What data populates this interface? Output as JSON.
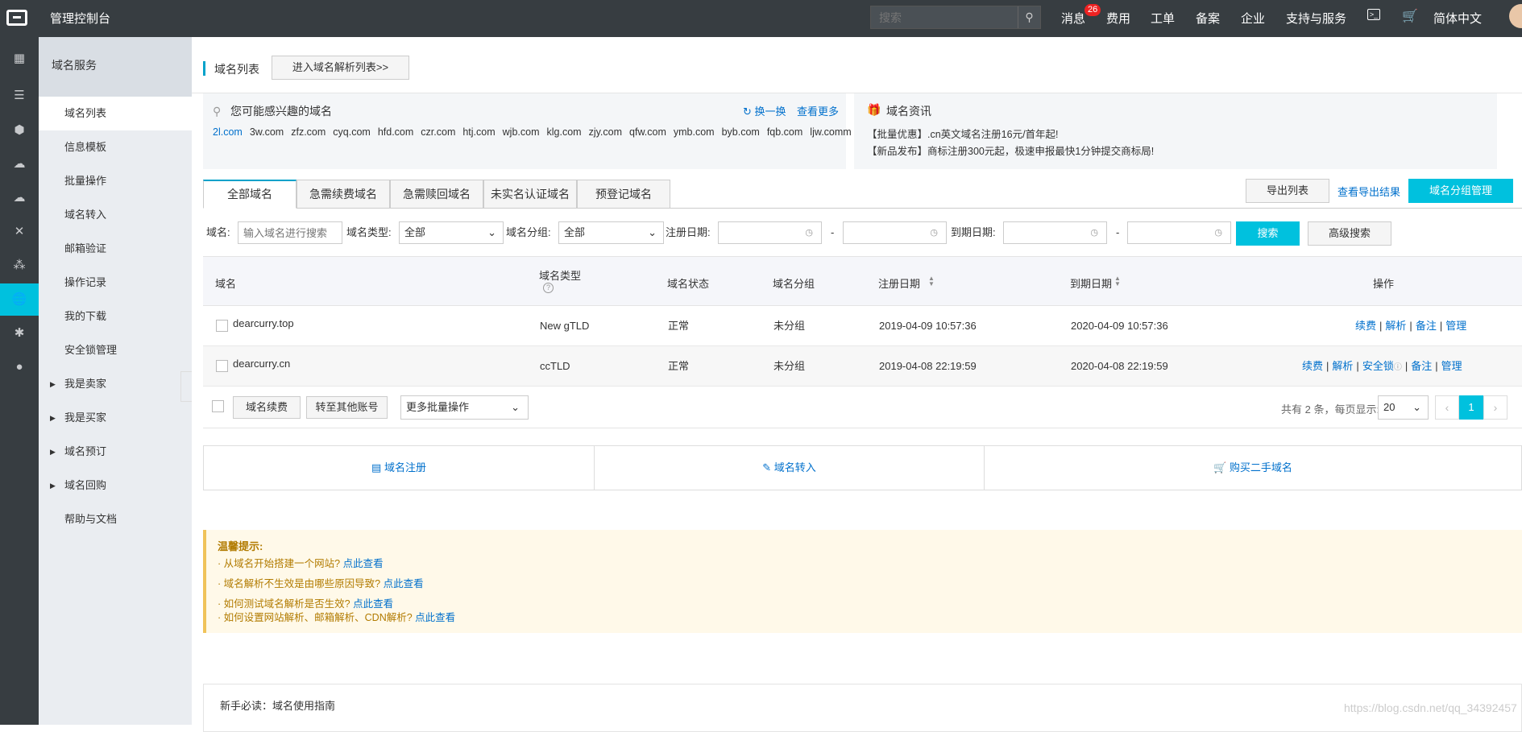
{
  "topbar": {
    "title": "管理控制台",
    "search_placeholder": "搜索",
    "nav": [
      "消息",
      "费用",
      "工单",
      "备案",
      "企业",
      "支持与服务",
      "简体中文"
    ],
    "messages_badge": "26"
  },
  "sidebar": {
    "header": "域名服务",
    "items": [
      {
        "label": "域名列表",
        "active": true,
        "expandable": false
      },
      {
        "label": "信息模板",
        "expandable": false
      },
      {
        "label": "批量操作",
        "expandable": false
      },
      {
        "label": "域名转入",
        "expandable": false
      },
      {
        "label": "邮箱验证",
        "expandable": false
      },
      {
        "label": "操作记录",
        "expandable": false
      },
      {
        "label": "我的下载",
        "expandable": false
      },
      {
        "label": "安全锁管理",
        "expandable": false
      },
      {
        "label": "我是卖家",
        "expandable": true
      },
      {
        "label": "我是买家",
        "expandable": true
      },
      {
        "label": "域名预订",
        "expandable": true
      },
      {
        "label": "域名回购",
        "expandable": true
      },
      {
        "label": "帮助与文档",
        "expandable": false
      }
    ]
  },
  "page": {
    "title": "域名列表",
    "goto_dns_button": "进入域名解析列表>>"
  },
  "suggest": {
    "title": "您可能感兴趣的域名",
    "refresh": "换一换",
    "more": "查看更多",
    "domains": [
      "2l.com",
      "3w.com",
      "zfz.com",
      "cyq.com",
      "hfd.com",
      "czr.com",
      "htj.com",
      "wjb.com",
      "klg.com",
      "zjy.com",
      "qfw.com",
      "ymb.com",
      "byb.com",
      "fqb.com",
      "ljw.comm"
    ]
  },
  "news": {
    "title": "域名资讯",
    "items": [
      "【批量优惠】.cn英文域名注册16元/首年起!",
      "【新品发布】商标注册300元起，极速申报最快1分钟提交商标局!"
    ]
  },
  "tabs": [
    "全部域名",
    "急需续费域名",
    "急需赎回域名",
    "未实名认证域名",
    "预登记域名"
  ],
  "toolbar": {
    "export": "导出列表",
    "view_export": "查看导出结果",
    "group_manage": "域名分组管理"
  },
  "filters": {
    "domain_label": "域名:",
    "domain_placeholder": "输入域名进行搜索",
    "type_label": "域名类型:",
    "type_value": "全部",
    "group_label": "域名分组:",
    "group_value": "全部",
    "reg_label": "注册日期:",
    "exp_label": "到期日期:",
    "dash": "-",
    "search": "搜索",
    "advanced": "高级搜索"
  },
  "table": {
    "headers": {
      "domain": "域名",
      "type": "域名类型",
      "status": "域名状态",
      "group": "域名分组",
      "reg_date": "注册日期",
      "exp_date": "到期日期",
      "ops": "操作"
    },
    "rows": [
      {
        "domain": "dearcurry.top",
        "type": "New gTLD",
        "status": "正常",
        "group": "未分组",
        "reg": "2019-04-09 10:57:36",
        "exp": "2020-04-09 10:57:36",
        "ops": [
          "续费",
          "解析",
          "备注",
          "管理"
        ]
      },
      {
        "domain": "dearcurry.cn",
        "type": "ccTLD",
        "status": "正常",
        "group": "未分组",
        "reg": "2019-04-08 22:19:59",
        "exp": "2020-04-08 22:19:59",
        "ops": [
          "续费",
          "解析",
          "安全锁",
          "备注",
          "管理"
        ]
      }
    ]
  },
  "footer_actions": {
    "renew": "域名续费",
    "transfer_account": "转至其他账号",
    "more_batch": "更多批量操作",
    "total_text": "共有 2 条，每页显示:",
    "page_size": "20",
    "current_page": "1"
  },
  "shortcuts": [
    "域名注册",
    "域名转入",
    "购买二手域名"
  ],
  "tips": {
    "title": "温馨提示:",
    "items": [
      {
        "text": "从域名开始搭建一个网站?",
        "link": "点此查看"
      },
      {
        "text": "域名解析不生效是由哪些原因导致?",
        "link": "点此查看"
      },
      {
        "text": "如何测试域名解析是否生效?",
        "link": "点此查看"
      },
      {
        "text": "如何设置网站解析、邮箱解析、CDN解析?",
        "link": "点此查看"
      }
    ]
  },
  "guide": {
    "title": "新手必读：域名使用指南"
  },
  "watermark": "https://blog.csdn.net/qq_34392457",
  "colors": {
    "accent": "#00c1de",
    "link": "#0070cc",
    "topbar": "#373d41",
    "tips_bg": "#fff9e9"
  }
}
